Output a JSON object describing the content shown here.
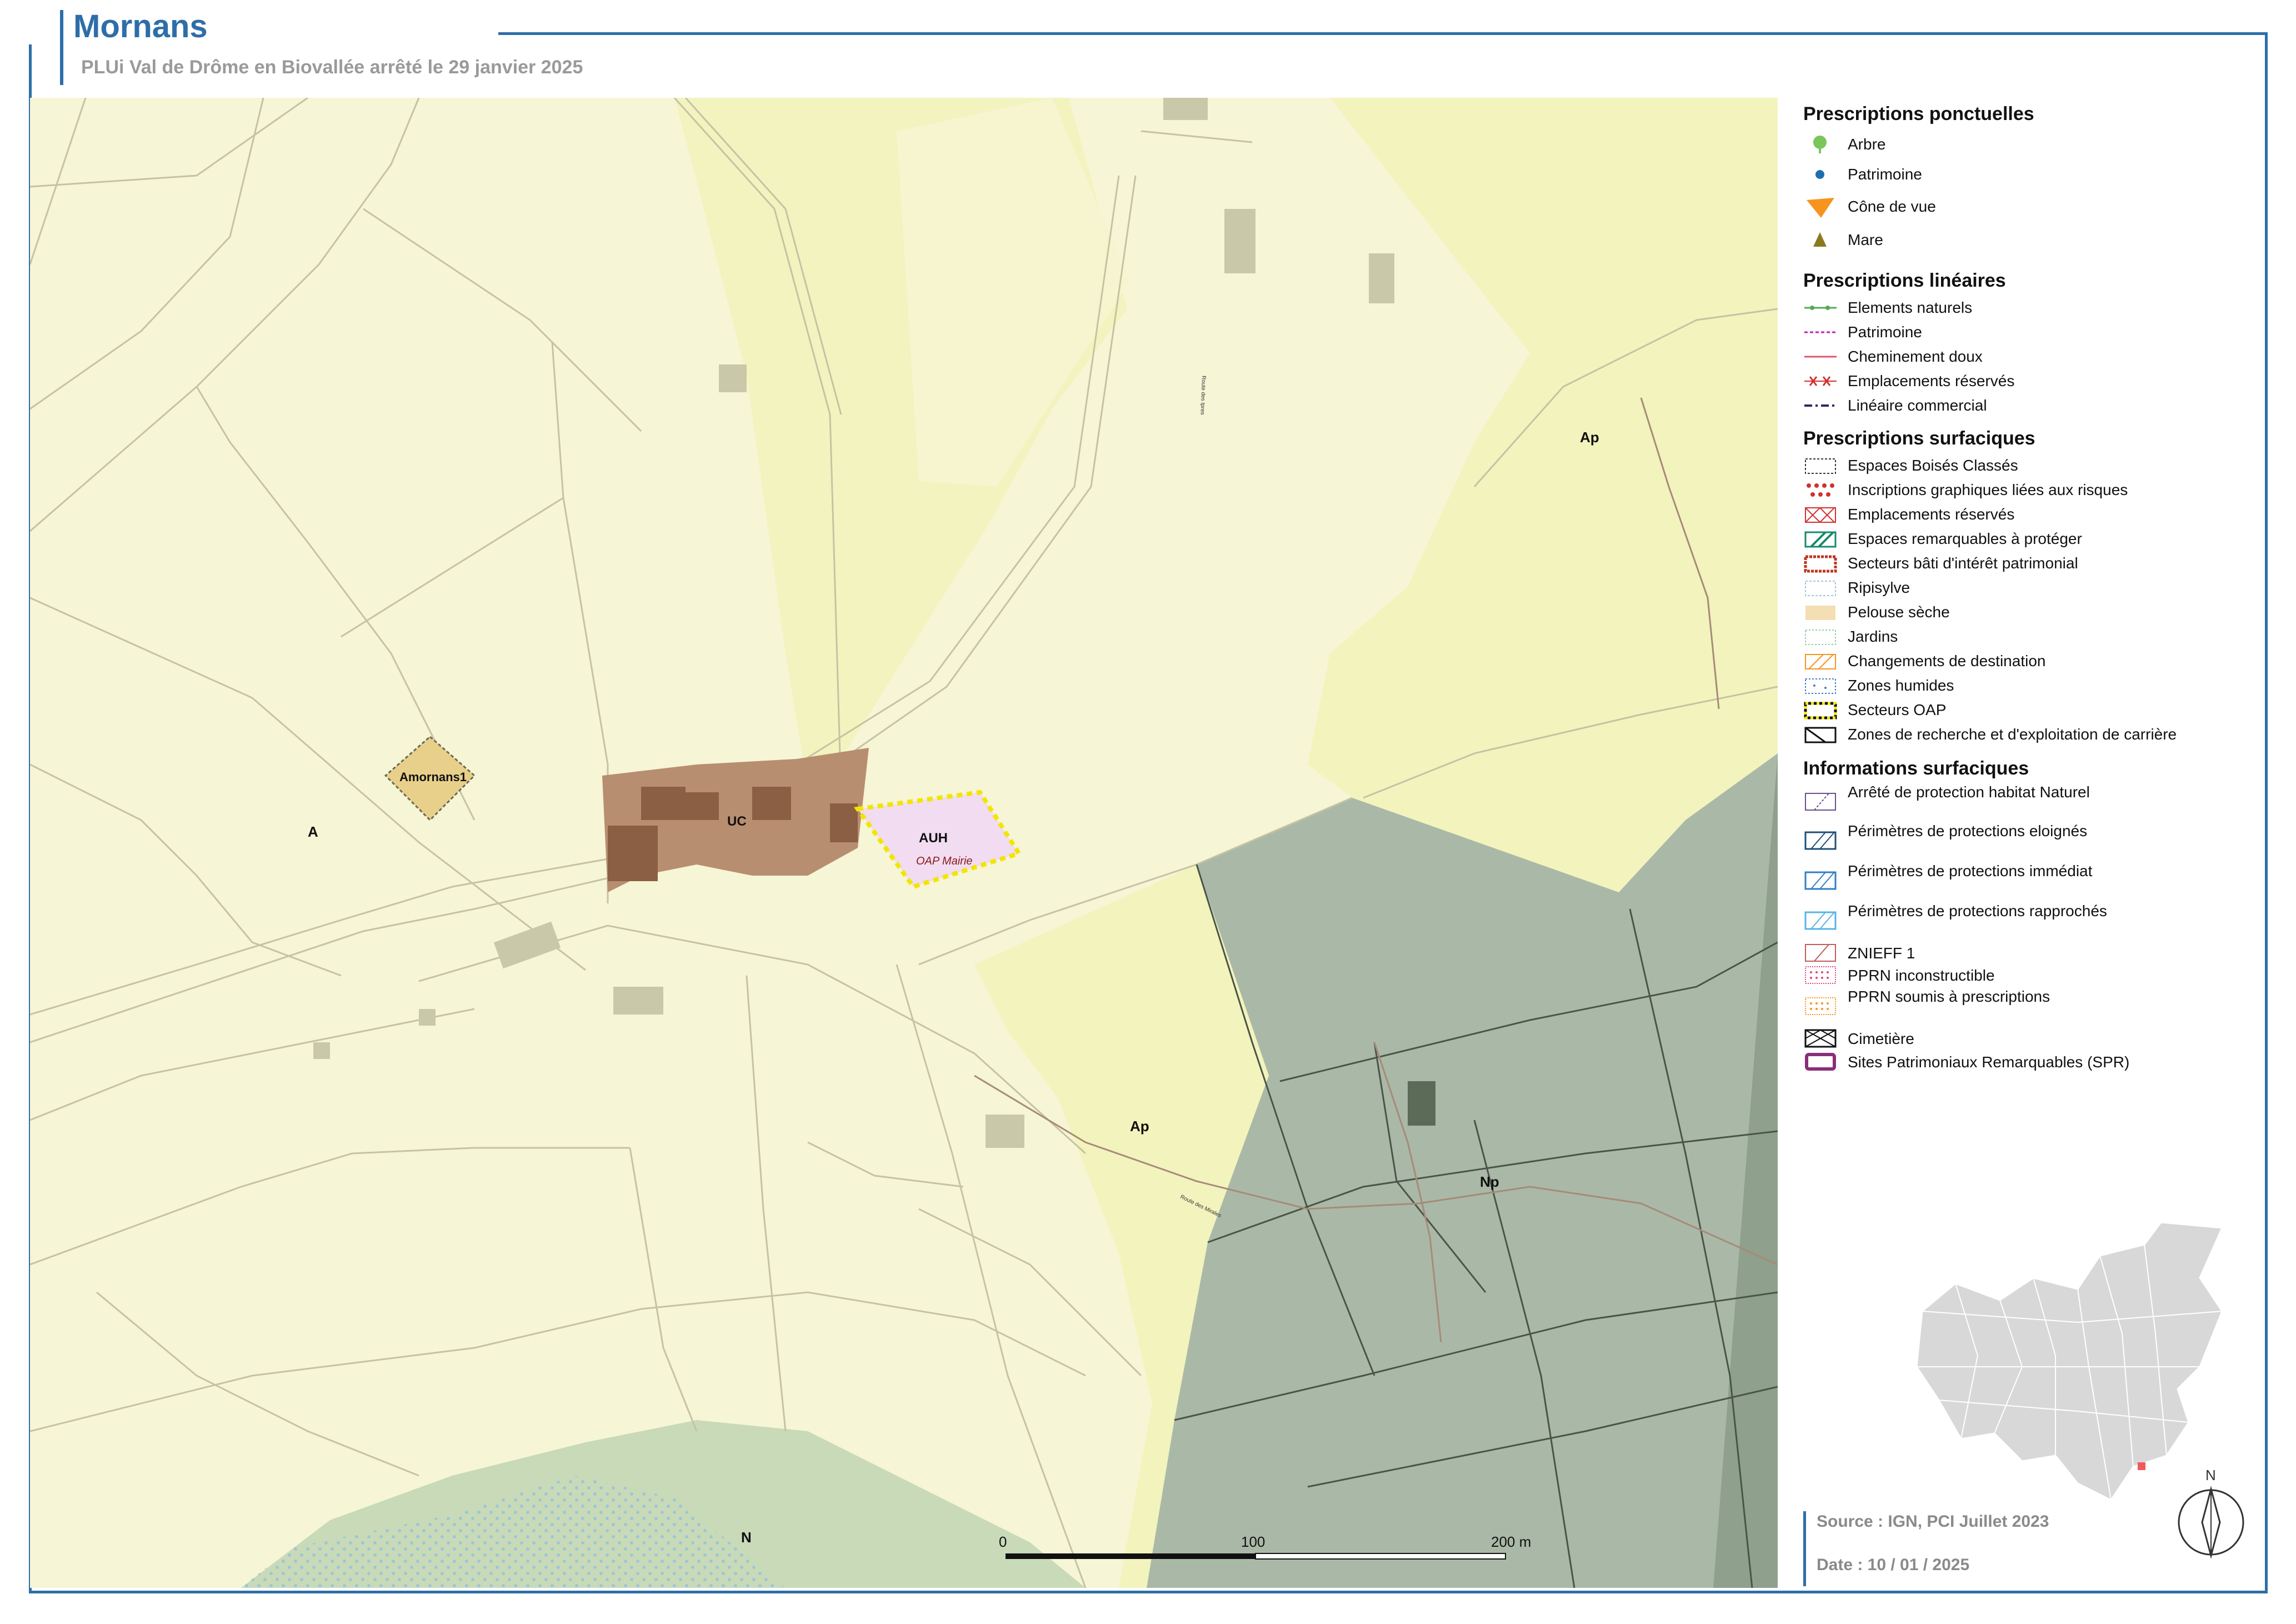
{
  "header": {
    "title": "Mornans",
    "subtitle": "PLUi Val de Drôme en Biovallée arrêté le 29 janvier 2025"
  },
  "map": {
    "zone_labels": [
      "A",
      "Ap",
      "Ap",
      "Np",
      "N",
      "UC",
      "AUH"
    ],
    "oap_label": "OAP Mairie",
    "site_label": "Amornans1",
    "road_labels": [
      "Route des Ipres",
      "Route des Mirales"
    ],
    "colors": {
      "zone_A": "#f6f5d6",
      "zone_Ap": "#f3f3bd",
      "zone_Np": "#aab9a7",
      "zone_N": "#c8dab8",
      "zone_UC": "#b88e70",
      "zone_AUH": "#f1dcf2",
      "building": "#c9c8a8",
      "parcel_line": "#c5c2a8",
      "road_line": "#9e8d80",
      "secteur_oap_border": "#f2e600"
    },
    "scale": {
      "labels": [
        "0",
        "100",
        "200 m"
      ]
    },
    "north_label": "N"
  },
  "legend": {
    "sections": [
      {
        "title": "Prescriptions ponctuelles",
        "items": [
          {
            "label": "Arbre",
            "icon": "tree-icon",
            "color": "#7bc65b"
          },
          {
            "label": "Patrimoine",
            "icon": "dot-icon",
            "color": "#1f6faf"
          },
          {
            "label": "Cône de vue",
            "icon": "view-cone-icon",
            "color": "#f7941d"
          },
          {
            "label": "Mare",
            "icon": "triangle-icon",
            "color": "#8a7a1f"
          }
        ]
      },
      {
        "title": "Prescriptions linéaires",
        "items": [
          {
            "label": "Elements naturels",
            "icon": "dotted-green-line-icon",
            "color": "#55a855"
          },
          {
            "label": "Patrimoine",
            "icon": "dashed-magenta-line-icon",
            "color": "#c51fb8"
          },
          {
            "label": "Cheminement doux",
            "icon": "red-line-icon",
            "color": "#e2556b"
          },
          {
            "label": "Emplacements réservés",
            "icon": "crossed-line-icon",
            "color": "#d2302f"
          },
          {
            "label": "Linéaire commercial",
            "icon": "dashdot-line-icon",
            "color": "#3a2060"
          }
        ]
      },
      {
        "title": "Prescriptions surfaciques",
        "items": [
          {
            "label": "Espaces Boisés Classés",
            "icon": "ebc-icon"
          },
          {
            "label": "Inscriptions graphiques liées aux risques",
            "icon": "risk-dots-icon"
          },
          {
            "label": "Emplacements réservés",
            "icon": "reserved-hatch-icon"
          },
          {
            "label": "Espaces remarquables à protéger",
            "icon": "green-hatch-icon"
          },
          {
            "label": "Secteurs bâti d'intérêt patrimonial",
            "icon": "heritage-border-icon"
          },
          {
            "label": "Ripisylve",
            "icon": "ripisylve-icon"
          },
          {
            "label": "Pelouse sèche",
            "icon": "pelouse-icon"
          },
          {
            "label": "Jardins",
            "icon": "jardins-icon"
          },
          {
            "label": "Changements de destination",
            "icon": "orange-hatch-icon"
          },
          {
            "label": "Zones humides",
            "icon": "wetland-icon"
          },
          {
            "label": "Secteurs OAP",
            "icon": "oap-border-icon"
          },
          {
            "label": "Zones de recherche et d'exploitation de carrière",
            "icon": "quarry-icon"
          }
        ]
      },
      {
        "title": "Informations surfaciques",
        "items": [
          {
            "label": "Arrêté de protection habitat Naturel",
            "icon": "purple-hatch-icon"
          },
          {
            "label": "Périmètres de protections eloignés",
            "icon": "darkblue-hatch-icon"
          },
          {
            "label": "Périmètres de protections immédiat",
            "icon": "blue-hatch-icon"
          },
          {
            "label": "Périmètres de protections rapprochés",
            "icon": "lightblue-hatch-icon"
          },
          {
            "label": "ZNIEFF 1",
            "icon": "znieff-hatch-icon"
          },
          {
            "label": "PPRN inconstructible",
            "icon": "pprn-red-icon"
          },
          {
            "label": "PPRN soumis à prescriptions",
            "icon": "pprn-orange-icon"
          },
          {
            "label": "Cimetière",
            "icon": "cemetery-icon"
          },
          {
            "label": "Sites Patrimoniaux Remarquables (SPR)",
            "icon": "spr-icon"
          }
        ]
      }
    ]
  },
  "footer": {
    "source": "Source : IGN, PCI Juillet 2023",
    "date": "Date : 10 / 01 / 2025"
  }
}
